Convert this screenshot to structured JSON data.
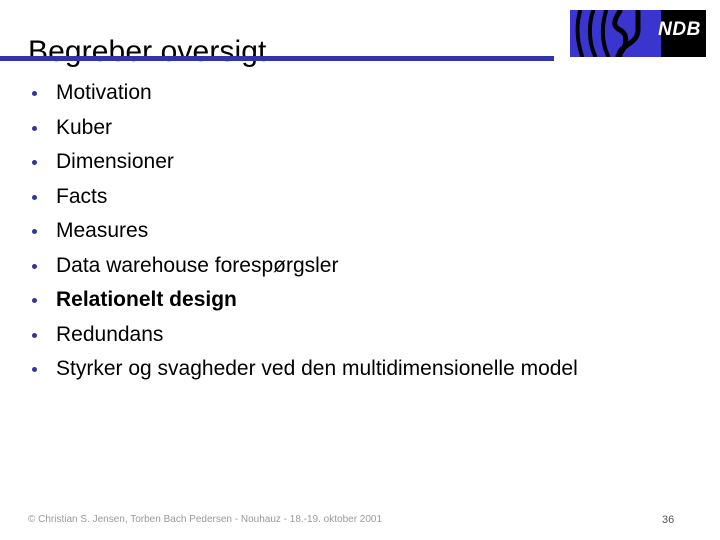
{
  "slide": {
    "title": "Begreber oversigt",
    "accent_color": "#3333aa",
    "bullet_color": "#33339f",
    "background_color": "#ffffff",
    "bullets": [
      {
        "label": "Motivation",
        "bold": false
      },
      {
        "label": "Kuber",
        "bold": false
      },
      {
        "label": "Dimensioner",
        "bold": false
      },
      {
        "label": "Facts",
        "bold": false
      },
      {
        "label": "Measures",
        "bold": false
      },
      {
        "label": "Data warehouse forespørgsler",
        "bold": false
      },
      {
        "label": "Relationelt design",
        "bold": true
      },
      {
        "label": "Redundans",
        "bold": false
      },
      {
        "label": "Styrker og svagheder ved den multidimensionelle model",
        "bold": false
      }
    ]
  },
  "logo": {
    "text": "NDB",
    "mark_color": "#3b35cf",
    "panel_color": "#000000",
    "text_color": "#ffffff"
  },
  "footer": {
    "credit": "© Christian S. Jensen, Torben Bach Pedersen - Nouhauz - 18.-19. oktober 2001",
    "page_number": "36"
  }
}
